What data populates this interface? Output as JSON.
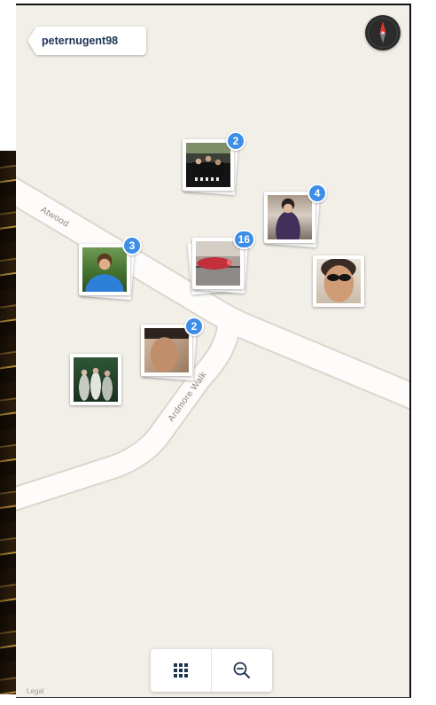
{
  "header": {
    "username": "peternugent98"
  },
  "compass": {
    "icon": "compass-icon"
  },
  "map": {
    "road_labels": [
      "Atwood",
      "Ardmore Walk"
    ],
    "legal": "Legal"
  },
  "photo_clusters": [
    {
      "count": 2
    },
    {
      "count": 4
    },
    {
      "count": 3
    },
    {
      "count": 16
    },
    {
      "count": null
    },
    {
      "count": 2
    },
    {
      "count": null
    }
  ],
  "toolbar": {
    "grid_button_icon": "grid-icon",
    "zoom_out_button_icon": "zoom-out-icon"
  },
  "colors": {
    "map_background": "#f2eee8",
    "road": "#fdfcfa",
    "road_edge": "#ddd6cd",
    "badge": "#3d8ee6",
    "icon": "#1e3450",
    "tag_text": "#1d3355",
    "compass": "#2b2b2b",
    "compass_needle": "#e0382e"
  }
}
